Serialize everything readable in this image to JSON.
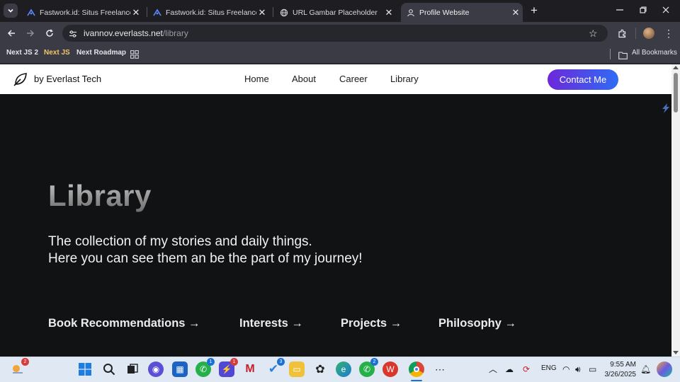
{
  "tabs": [
    {
      "title": "Fastwork.id: Situs Freelance Onl",
      "icon": "fastwork-icon",
      "active": false
    },
    {
      "title": "Fastwork.id: Situs Freelance Onl",
      "icon": "fastwork-icon",
      "active": false
    },
    {
      "title": "URL Gambar Placeholder",
      "icon": "globe-icon",
      "active": false
    },
    {
      "title": "Profile Website",
      "icon": "profile-icon",
      "active": true
    }
  ],
  "new_tab_label": "+",
  "address": {
    "host": "ivannov.everlasts.net",
    "path": "/library"
  },
  "bookmarks": {
    "items": [
      "Next JS 2",
      "Next JS",
      "Next Roadmap"
    ],
    "all_label": "All Bookmarks"
  },
  "site": {
    "brand": "by Everlast Tech",
    "nav": [
      "Home",
      "About",
      "Career",
      "Library"
    ],
    "contact": "Contact Me",
    "hero_title": "Library",
    "hero_line1": "The collection of my stories and daily things.",
    "hero_line2": "Here you can see them an be the part of my journey!",
    "links": [
      "Book Recommendations →",
      "Interests →",
      "Projects →",
      "Philosophy →"
    ]
  },
  "taskbar": {
    "badges": {
      "weather": "2",
      "whatsapp": "1",
      "app_red": "1",
      "todo": "3",
      "whatsapp2": "2"
    },
    "lang": "ENG",
    "time": "9:55 AM",
    "date": "3/26/2025"
  },
  "colors": {
    "accent_start": "#6d28d9",
    "accent_end": "#2f6cf5",
    "page_bg": "#101214"
  }
}
